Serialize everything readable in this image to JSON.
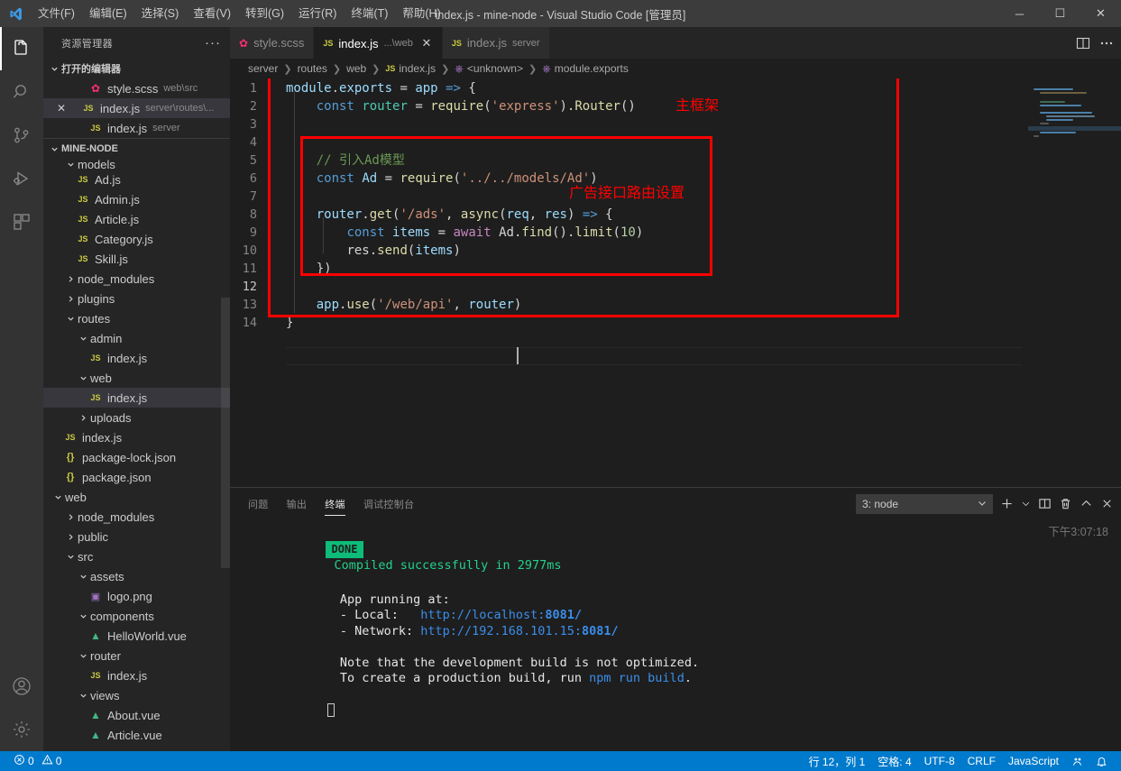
{
  "window": {
    "title": "index.js - mine-node - Visual Studio Code [管理员]",
    "minimize": "─",
    "maximize": "☐",
    "close": "✕"
  },
  "menu": [
    {
      "label": "文件(F)"
    },
    {
      "label": "编辑(E)"
    },
    {
      "label": "选择(S)"
    },
    {
      "label": "查看(V)"
    },
    {
      "label": "转到(G)"
    },
    {
      "label": "运行(R)"
    },
    {
      "label": "终端(T)"
    },
    {
      "label": "帮助(H)"
    }
  ],
  "activitybar": [
    {
      "name": "explorer-icon",
      "active": true
    },
    {
      "name": "search-icon",
      "active": false
    },
    {
      "name": "source-control-icon",
      "active": false
    },
    {
      "name": "run-debug-icon",
      "active": false
    },
    {
      "name": "extensions-icon",
      "active": false
    },
    {
      "name": "accounts-icon",
      "active": false
    },
    {
      "name": "settings-gear-icon",
      "active": false
    }
  ],
  "sidebar": {
    "title": "资源管理器",
    "more_actions": "···",
    "open_editors": {
      "title": "打开的编辑器",
      "items": [
        {
          "label": "style.scss",
          "desc": "web\\src",
          "icon": "scss",
          "selected": false,
          "dirty": false
        },
        {
          "label": "index.js",
          "desc": "server\\routes\\...",
          "icon": "js",
          "selected": true,
          "dirty": true
        },
        {
          "label": "index.js",
          "desc": "server",
          "icon": "js",
          "selected": false,
          "dirty": false
        }
      ]
    },
    "project": {
      "title": "MINE-NODE",
      "items": [
        {
          "label": "models",
          "type": "folder",
          "expanded": true,
          "indent": 1,
          "clipped": true
        },
        {
          "label": "Ad.js",
          "type": "js",
          "indent": 2
        },
        {
          "label": "Admin.js",
          "type": "js",
          "indent": 2
        },
        {
          "label": "Article.js",
          "type": "js",
          "indent": 2
        },
        {
          "label": "Category.js",
          "type": "js",
          "indent": 2
        },
        {
          "label": "Skill.js",
          "type": "js",
          "indent": 2
        },
        {
          "label": "node_modules",
          "type": "folder",
          "expanded": false,
          "indent": 1
        },
        {
          "label": "plugins",
          "type": "folder",
          "expanded": false,
          "indent": 1
        },
        {
          "label": "routes",
          "type": "folder",
          "expanded": true,
          "indent": 1
        },
        {
          "label": "admin",
          "type": "folder",
          "expanded": true,
          "indent": 2
        },
        {
          "label": "index.js",
          "type": "js",
          "indent": 3
        },
        {
          "label": "web",
          "type": "folder",
          "expanded": true,
          "indent": 2
        },
        {
          "label": "index.js",
          "type": "js",
          "indent": 3,
          "selected": true
        },
        {
          "label": "uploads",
          "type": "folder",
          "expanded": false,
          "indent": 2
        },
        {
          "label": "index.js",
          "type": "js",
          "indent": 1
        },
        {
          "label": "package-lock.json",
          "type": "json",
          "indent": 1
        },
        {
          "label": "package.json",
          "type": "json",
          "indent": 1
        },
        {
          "label": "web",
          "type": "folder",
          "expanded": true,
          "indent": 0
        },
        {
          "label": "node_modules",
          "type": "folder",
          "expanded": false,
          "indent": 1
        },
        {
          "label": "public",
          "type": "folder",
          "expanded": false,
          "indent": 1
        },
        {
          "label": "src",
          "type": "folder",
          "expanded": true,
          "indent": 1
        },
        {
          "label": "assets",
          "type": "folder",
          "expanded": true,
          "indent": 2
        },
        {
          "label": "logo.png",
          "type": "png",
          "indent": 3
        },
        {
          "label": "components",
          "type": "folder",
          "expanded": true,
          "indent": 2
        },
        {
          "label": "HelloWorld.vue",
          "type": "vue",
          "indent": 3
        },
        {
          "label": "router",
          "type": "folder",
          "expanded": true,
          "indent": 2
        },
        {
          "label": "index.js",
          "type": "js",
          "indent": 3
        },
        {
          "label": "views",
          "type": "folder",
          "expanded": true,
          "indent": 2
        },
        {
          "label": "About.vue",
          "type": "vue",
          "indent": 3
        },
        {
          "label": "Article.vue",
          "type": "vue",
          "indent": 3
        }
      ]
    }
  },
  "tabs": [
    {
      "label": "style.scss",
      "desc": "",
      "icon": "scss",
      "active": false,
      "closable": false
    },
    {
      "label": "index.js",
      "desc": "...\\web",
      "icon": "js",
      "active": true,
      "closable": true
    },
    {
      "label": "index.js",
      "desc": "server",
      "icon": "js",
      "active": false,
      "closable": false
    }
  ],
  "breadcrumb": [
    {
      "label": "server",
      "icon": ""
    },
    {
      "label": "routes",
      "icon": ""
    },
    {
      "label": "web",
      "icon": ""
    },
    {
      "label": "index.js",
      "icon": "js"
    },
    {
      "label": "<unknown>",
      "icon": "symbol"
    },
    {
      "label": "module.exports",
      "icon": "symbol"
    }
  ],
  "editor": {
    "lines": [
      {
        "n": "1",
        "tokens": [
          {
            "t": "module",
            "c": "tok-var"
          },
          {
            "t": ".",
            "c": "tok-pl"
          },
          {
            "t": "exports",
            "c": "tok-var"
          },
          {
            "t": " = ",
            "c": "tok-pl"
          },
          {
            "t": "app",
            "c": "tok-var"
          },
          {
            "t": " ",
            "c": "tok-pl"
          },
          {
            "t": "=>",
            "c": "tok-kw"
          },
          {
            "t": " {",
            "c": "tok-pl"
          }
        ]
      },
      {
        "n": "2",
        "tokens": [
          {
            "t": "    ",
            "c": "tok-pl"
          },
          {
            "t": "const",
            "c": "tok-kw"
          },
          {
            "t": " ",
            "c": "tok-pl"
          },
          {
            "t": "router",
            "c": "tok-cls"
          },
          {
            "t": " = ",
            "c": "tok-pl"
          },
          {
            "t": "require",
            "c": "tok-fn"
          },
          {
            "t": "(",
            "c": "tok-pl"
          },
          {
            "t": "'express'",
            "c": "tok-str"
          },
          {
            "t": ").",
            "c": "tok-pl"
          },
          {
            "t": "Router",
            "c": "tok-fn"
          },
          {
            "t": "()",
            "c": "tok-pl"
          }
        ]
      },
      {
        "n": "3",
        "tokens": []
      },
      {
        "n": "4",
        "tokens": []
      },
      {
        "n": "5",
        "tokens": [
          {
            "t": "    ",
            "c": "tok-pl"
          },
          {
            "t": "// 引入Ad模型",
            "c": "tok-cmt"
          }
        ]
      },
      {
        "n": "6",
        "tokens": [
          {
            "t": "    ",
            "c": "tok-pl"
          },
          {
            "t": "const",
            "c": "tok-kw"
          },
          {
            "t": " ",
            "c": "tok-pl"
          },
          {
            "t": "Ad",
            "c": "tok-var"
          },
          {
            "t": " = ",
            "c": "tok-pl"
          },
          {
            "t": "require",
            "c": "tok-fn"
          },
          {
            "t": "(",
            "c": "tok-pl"
          },
          {
            "t": "'../../models/Ad'",
            "c": "tok-str"
          },
          {
            "t": ")",
            "c": "tok-pl"
          }
        ]
      },
      {
        "n": "7",
        "tokens": []
      },
      {
        "n": "8",
        "tokens": [
          {
            "t": "    ",
            "c": "tok-pl"
          },
          {
            "t": "router",
            "c": "tok-var"
          },
          {
            "t": ".",
            "c": "tok-pl"
          },
          {
            "t": "get",
            "c": "tok-fn"
          },
          {
            "t": "(",
            "c": "tok-pl"
          },
          {
            "t": "'/ads'",
            "c": "tok-str"
          },
          {
            "t": ", ",
            "c": "tok-pl"
          },
          {
            "t": "async",
            "c": "tok-fn"
          },
          {
            "t": "(",
            "c": "tok-pl"
          },
          {
            "t": "req",
            "c": "tok-var"
          },
          {
            "t": ", ",
            "c": "tok-pl"
          },
          {
            "t": "res",
            "c": "tok-var"
          },
          {
            "t": ") ",
            "c": "tok-pl"
          },
          {
            "t": "=>",
            "c": "tok-kw"
          },
          {
            "t": " {",
            "c": "tok-pl"
          }
        ]
      },
      {
        "n": "9",
        "tokens": [
          {
            "t": "        ",
            "c": "tok-pl"
          },
          {
            "t": "const",
            "c": "tok-kw"
          },
          {
            "t": " ",
            "c": "tok-pl"
          },
          {
            "t": "items",
            "c": "tok-var"
          },
          {
            "t": " = ",
            "c": "tok-pl"
          },
          {
            "t": "await",
            "c": "tok-kw2"
          },
          {
            "t": " ",
            "c": "tok-pl"
          },
          {
            "t": "Ad",
            "c": "tok-pl"
          },
          {
            "t": ".",
            "c": "tok-pl"
          },
          {
            "t": "find",
            "c": "tok-fn"
          },
          {
            "t": "().",
            "c": "tok-pl"
          },
          {
            "t": "limit",
            "c": "tok-fn"
          },
          {
            "t": "(",
            "c": "tok-pl"
          },
          {
            "t": "10",
            "c": "tok-num"
          },
          {
            "t": ")",
            "c": "tok-pl"
          }
        ]
      },
      {
        "n": "10",
        "tokens": [
          {
            "t": "        ",
            "c": "tok-pl"
          },
          {
            "t": "res",
            "c": "tok-pl"
          },
          {
            "t": ".",
            "c": "tok-pl"
          },
          {
            "t": "send",
            "c": "tok-fn"
          },
          {
            "t": "(",
            "c": "tok-pl"
          },
          {
            "t": "items",
            "c": "tok-var"
          },
          {
            "t": ")",
            "c": "tok-pl"
          }
        ]
      },
      {
        "n": "11",
        "tokens": [
          {
            "t": "    })",
            "c": "tok-pl"
          }
        ]
      },
      {
        "n": "12",
        "tokens": [],
        "current": true
      },
      {
        "n": "13",
        "tokens": [
          {
            "t": "    ",
            "c": "tok-pl"
          },
          {
            "t": "app",
            "c": "tok-var"
          },
          {
            "t": ".",
            "c": "tok-pl"
          },
          {
            "t": "use",
            "c": "tok-fn"
          },
          {
            "t": "(",
            "c": "tok-pl"
          },
          {
            "t": "'/web/api'",
            "c": "tok-str"
          },
          {
            "t": ", ",
            "c": "tok-pl"
          },
          {
            "t": "router",
            "c": "tok-var"
          },
          {
            "t": ")",
            "c": "tok-pl"
          }
        ]
      },
      {
        "n": "14",
        "tokens": [
          {
            "t": "}",
            "c": "tok-pl"
          }
        ]
      }
    ],
    "annotations": [
      {
        "name": "main-frame-annotation",
        "text": "主框架"
      },
      {
        "name": "ad-route-annotation",
        "text": "广告接口路由设置"
      }
    ],
    "annotation_color": "#ff0000"
  },
  "panel": {
    "tabs": [
      {
        "label": "问题",
        "active": false
      },
      {
        "label": "输出",
        "active": false
      },
      {
        "label": "终端",
        "active": true
      },
      {
        "label": "调试控制台",
        "active": false
      }
    ],
    "terminal_select": "3: node",
    "actions": [
      {
        "name": "new-terminal-icon",
        "glyph": "+"
      },
      {
        "name": "chevron-down-icon",
        "glyph": "⌄"
      },
      {
        "name": "split-terminal-icon",
        "glyph": "split"
      },
      {
        "name": "kill-terminal-icon",
        "glyph": "trash"
      },
      {
        "name": "maximize-panel-icon",
        "glyph": "^"
      },
      {
        "name": "close-panel-icon",
        "glyph": "✕"
      }
    ],
    "timestamp": "下午3:07:18",
    "terminal_output": {
      "done_badge": "DONE",
      "compiled_msg": "Compiled successfully in 2977ms",
      "app_running": "App running at:",
      "local_label": "- Local:   ",
      "local_url_text": "http://localhost:",
      "local_port": "8081/",
      "network_label": "- Network: ",
      "network_url_text": "http://192.168.101.15:",
      "network_port": "8081/",
      "note_line": "Note that the development build is not optimized.",
      "prod_line_pre": "To create a production build, run ",
      "prod_cmd": "npm run build",
      "prod_line_post": "."
    }
  },
  "statusbar": {
    "errors": "0",
    "warnings": "0",
    "line_col": "行 12，列 1",
    "spaces": "空格: 4",
    "encoding": "UTF-8",
    "eol": "CRLF",
    "language": "JavaScript",
    "feedback_icon": "smiley-icon",
    "bell_icon": "bell-icon"
  }
}
